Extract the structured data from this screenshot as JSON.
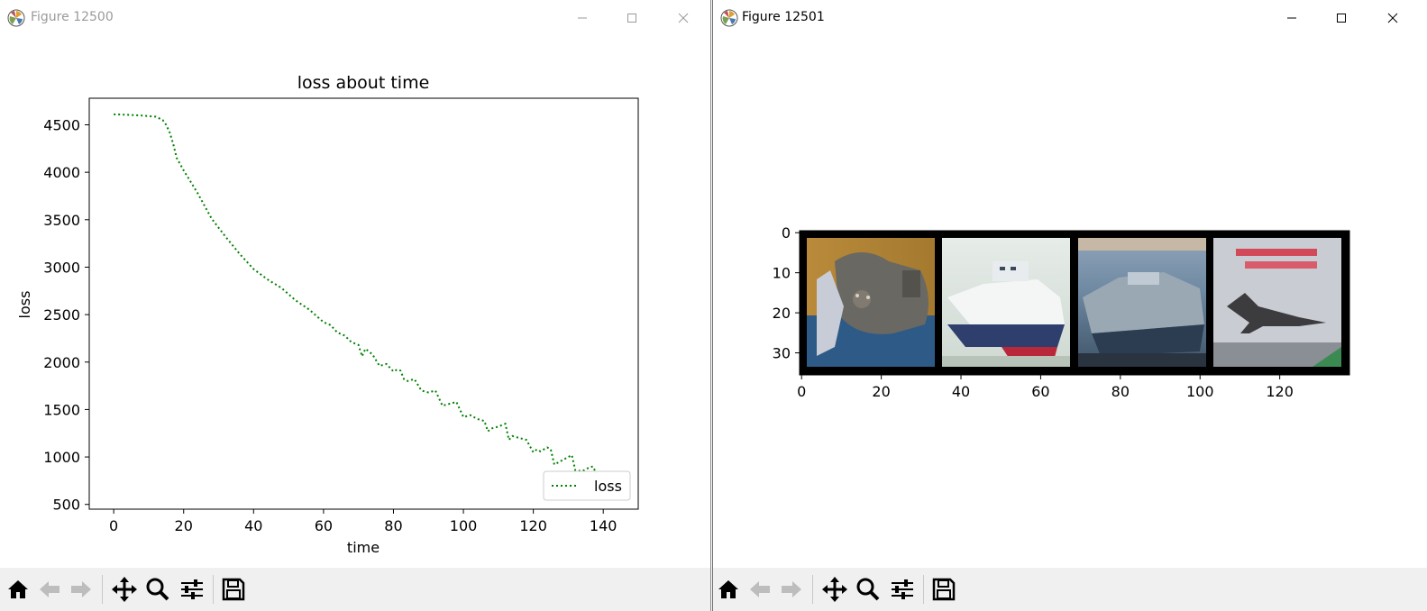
{
  "windows": [
    {
      "title": "Figure 12500",
      "chart_data": {
        "type": "line",
        "title": "loss about time",
        "xlabel": "time",
        "ylabel": "loss",
        "xlim": [
          -7,
          150
        ],
        "ylim": [
          450,
          4780
        ],
        "xticks": [
          0,
          20,
          40,
          60,
          80,
          100,
          120,
          140
        ],
        "yticks": [
          500,
          1000,
          1500,
          2000,
          2500,
          3000,
          3500,
          4000,
          4500
        ],
        "legend_position": "lower right",
        "grid": false,
        "series": [
          {
            "name": "loss",
            "color": "#008000",
            "linestyle": "dotted",
            "x": [
              0,
              4,
              8,
              12,
              14,
              15,
              16,
              17,
              18,
              20,
              24,
              28,
              32,
              36,
              40,
              44,
              48,
              52,
              56,
              60,
              62,
              64,
              66,
              68,
              70,
              71,
              72,
              74,
              76,
              78,
              80,
              81,
              82,
              83,
              84,
              86,
              88,
              90,
              92,
              94,
              96,
              98,
              100,
              102,
              104,
              106,
              107,
              108,
              110,
              112,
              113,
              114,
              116,
              118,
              120,
              121,
              122,
              124,
              125,
              126,
              128,
              130,
              131,
              132,
              134,
              136,
              137,
              138
            ],
            "y": [
              4610,
              4605,
              4598,
              4585,
              4550,
              4500,
              4420,
              4300,
              4150,
              4020,
              3780,
              3510,
              3320,
              3140,
              2980,
              2870,
              2780,
              2650,
              2550,
              2420,
              2390,
              2310,
              2280,
              2210,
              2180,
              2060,
              2140,
              2080,
              1960,
              1980,
              1900,
              1920,
              1910,
              1820,
              1800,
              1820,
              1700,
              1680,
              1700,
              1540,
              1560,
              1580,
              1420,
              1440,
              1400,
              1380,
              1270,
              1300,
              1320,
              1350,
              1180,
              1220,
              1200,
              1180,
              1050,
              1080,
              1060,
              1100,
              1080,
              920,
              960,
              1000,
              1020,
              860,
              850,
              890,
              900,
              830
            ]
          }
        ]
      }
    },
    {
      "title": "Figure 12501",
      "chart_data": {
        "type": "image",
        "xticks": [
          0,
          20,
          40,
          60,
          80,
          100,
          120
        ],
        "yticks": [
          0,
          10,
          20,
          30
        ],
        "xlim": [
          -0.5,
          137.5
        ],
        "ylim": [
          35.5,
          -0.5
        ],
        "panels": [
          "cat",
          "ship",
          "ship",
          "airplane"
        ]
      }
    }
  ],
  "icons": {
    "app": "matplotlib-icon",
    "minimize": "minimize-icon",
    "maximize": "maximize-icon",
    "close": "close-icon",
    "home": "home-icon",
    "back": "back-arrow-icon",
    "forward": "forward-arrow-icon",
    "pan": "pan-move-icon",
    "zoom": "zoom-magnifier-icon",
    "configure": "configure-subplots-icon",
    "save": "save-floppy-icon"
  },
  "colors": {
    "toolbar_bg": "#f0f0f0",
    "inactive_title": "#9a9a9a",
    "active_title": "#000000",
    "line": "#008000"
  }
}
